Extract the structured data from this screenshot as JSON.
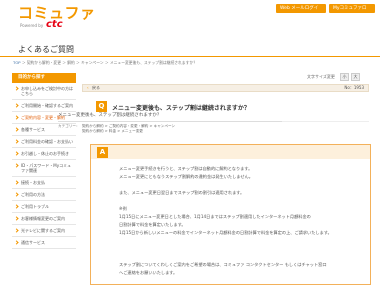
{
  "header": {
    "logo": "コミュファ",
    "logo_sub": "Powered by",
    "logo_brand": "ctc",
    "btn_top": "Web メールログイン",
    "btn_my": "MyコミュファログインNS"
  },
  "page": {
    "title": "よくあるご質問",
    "breadcrumb_prefix": "TOP",
    "breadcrumb": "＞ 契約から解約・変更 ＞ 解約 ＞ キャンペーン ＞ メニュー変更後も、ステップ割は継続されますか？"
  },
  "sidebar": {
    "heading": "目的から探す",
    "items": [
      {
        "label": "お申し込みをご検討中の方はこちら"
      },
      {
        "label": "ご利用開始・確認するご案内"
      },
      {
        "label": "ご契約内容・変更・解約",
        "active": true
      },
      {
        "label": "各種サービス"
      },
      {
        "label": "ご利用料金の確認・お支払い"
      },
      {
        "label": "お引越し・休止のお手続き"
      },
      {
        "label": "ID・パスワード・Myコミュファ関連"
      },
      {
        "label": "接続・お支払"
      },
      {
        "label": "ご利用の方法"
      },
      {
        "label": "ご利用トラブル"
      },
      {
        "label": "お客様情報変更のご案内"
      },
      {
        "label": "光テレビに関するご案内"
      },
      {
        "label": "通信サービス"
      }
    ]
  },
  "main": {
    "font_size_label": "文字サイズ変更",
    "font_small": "小",
    "font_large": "大",
    "back_label": "戻る",
    "faq_no": "No：1953",
    "question": "メニュー変更後も、ステップ割は継続されますか？",
    "question_sub": "メニュー変更後も、ステップ割は継続されますか？",
    "category_label": "カテゴリー：",
    "category_1": "契約から解約 > ご契約内容・変更・解約 > キャンペーン",
    "category_2": "契約から解約 > 料金 > メニュー変更",
    "answer_lines": [
      "メニュー変更手続きを行うと、ステップ割は自動的に解約となります。",
      "メニュー変更にともなうステップ割解約の違約金は発生いたしません。",
      "",
      "また、メニュー変更日翌日までステップ割の割引は適用されます。",
      "",
      "※例",
      "1月15日にメニュー変更日とした場合、1月14日まではステップ割適用したインターネット月額料金の",
      "日割計算で料金を算定いたします。",
      "1月15日から新しいメニューの料金でインターネット月額料金の日割計算で料金を算定の上、ご請求いたします。",
      "",
      "",
      "ステップ割についてくわしくご案内をご希望の場合は、コミュファ コンタクトセンター もしくはチャット窓口",
      "へご連絡をお願いいたします。"
    ]
  },
  "colors": {
    "accent": "#f39800"
  }
}
